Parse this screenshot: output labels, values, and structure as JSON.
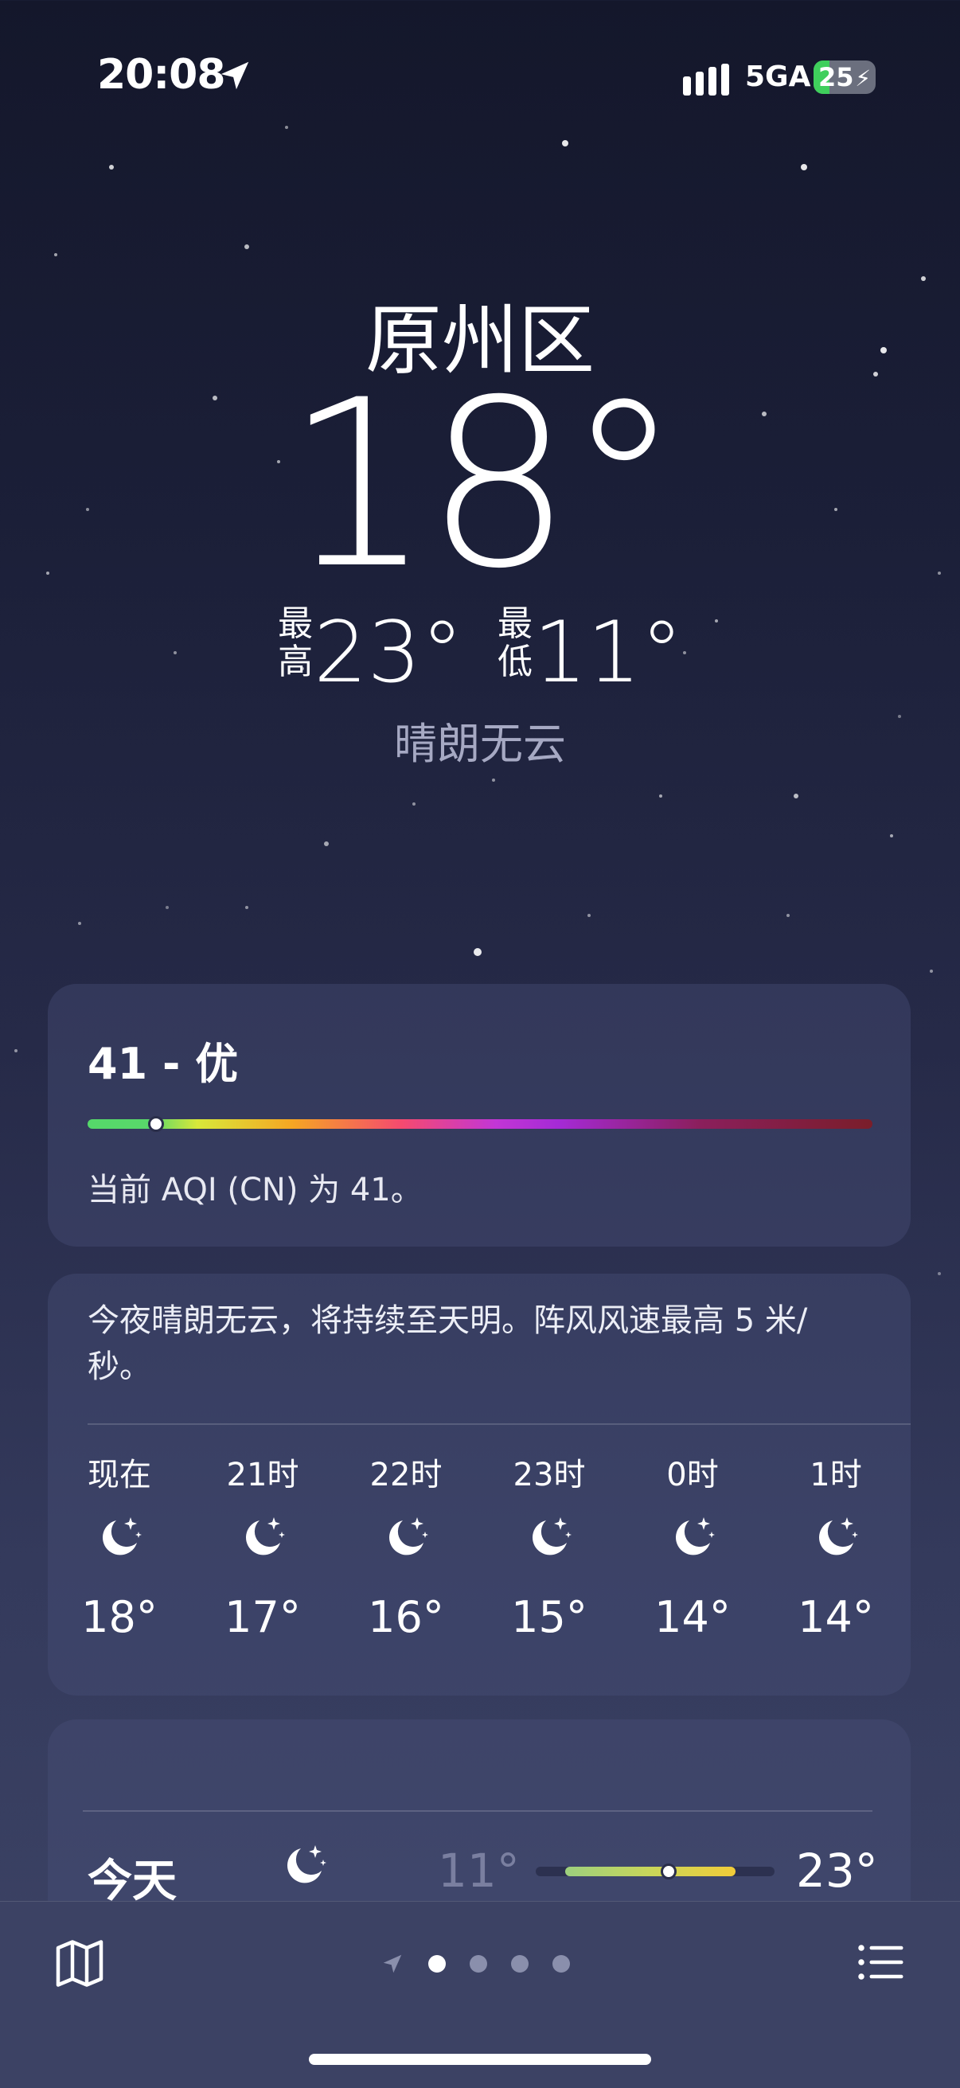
{
  "status_bar": {
    "time": "20:08",
    "network": "5GA",
    "battery": "25"
  },
  "location": {
    "name": "原州区"
  },
  "current": {
    "temperature": "18°",
    "high_label": "最高",
    "high": "23°",
    "low_label": "最低",
    "low": "11°",
    "condition": "晴朗无云"
  },
  "aqi": {
    "title": "41 - 优",
    "description": "当前 AQI (CN) 为 41。",
    "value": 41
  },
  "hourly": {
    "summary": "今夜晴朗无云，将持续至天明。阵风风速最高 5 米/秒。",
    "hours": [
      {
        "label": "现在",
        "icon": "moon-stars-icon",
        "temp": "18°"
      },
      {
        "label": "21时",
        "icon": "moon-stars-icon",
        "temp": "17°"
      },
      {
        "label": "22时",
        "icon": "moon-stars-icon",
        "temp": "16°"
      },
      {
        "label": "23时",
        "icon": "moon-stars-icon",
        "temp": "15°"
      },
      {
        "label": "0时",
        "icon": "moon-stars-icon",
        "temp": "14°"
      },
      {
        "label": "1时",
        "icon": "moon-stars-icon",
        "temp": "14°"
      }
    ]
  },
  "daily": {
    "rows": [
      {
        "day": "今天",
        "icon": "moon-stars-icon",
        "low": "11°",
        "high": "23°"
      }
    ]
  },
  "toolbar": {
    "map_icon": "map-icon",
    "list_icon": "list-icon",
    "page_count": 4,
    "active_page": 1
  },
  "colors": {
    "battery_green": "#3fcf5c",
    "condition_gray": "#a6a9c3"
  }
}
